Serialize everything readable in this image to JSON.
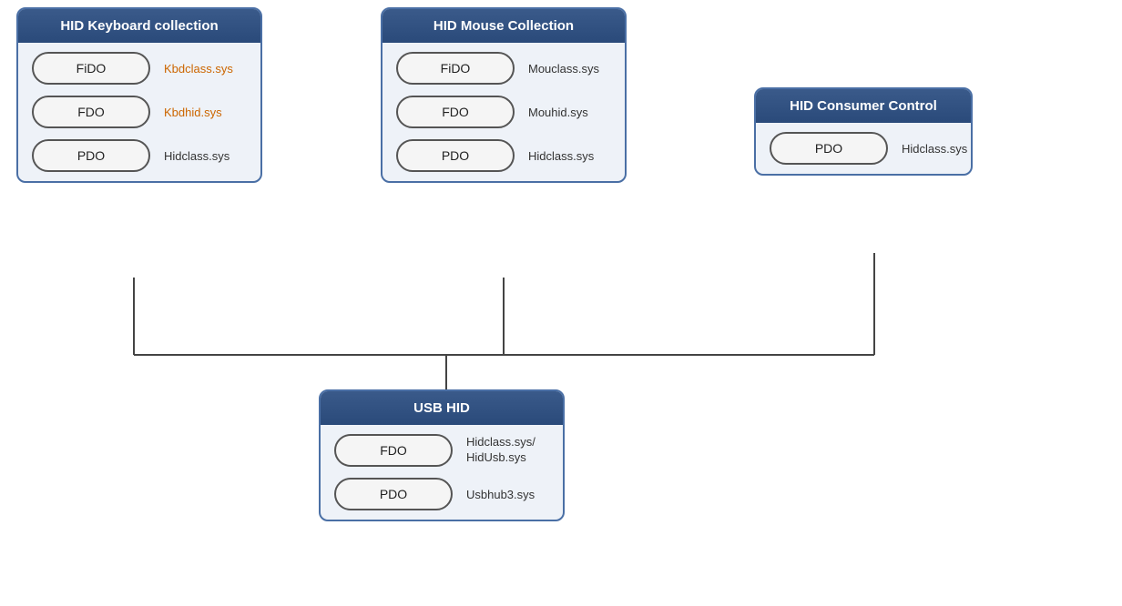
{
  "keyboard": {
    "title": "HID Keyboard collection",
    "nodes": [
      {
        "label": "FiDO",
        "sys": "Kbdclass.sys",
        "sys_color": "orange"
      },
      {
        "label": "FDO",
        "sys": "Kbdhid.sys",
        "sys_color": "orange"
      },
      {
        "label": "PDO",
        "sys": "Hidclass.sys",
        "sys_color": "dark"
      }
    ]
  },
  "mouse": {
    "title": "HID Mouse Collection",
    "nodes": [
      {
        "label": "FiDO",
        "sys": "Mouclass.sys",
        "sys_color": "dark"
      },
      {
        "label": "FDO",
        "sys": "Mouhid.sys",
        "sys_color": "dark"
      },
      {
        "label": "PDO",
        "sys": "Hidclass.sys",
        "sys_color": "dark"
      }
    ]
  },
  "consumer": {
    "title": "HID Consumer Control",
    "nodes": [
      {
        "label": "PDO",
        "sys": "Hidclass.sys",
        "sys_color": "dark"
      }
    ]
  },
  "usbhid": {
    "title": "USB HID",
    "nodes": [
      {
        "label": "FDO",
        "sys": "Hidclass.sys/\nHidUsb.sys",
        "sys_color": "dark"
      },
      {
        "label": "PDO",
        "sys": "Usbhub3.sys",
        "sys_color": "dark"
      }
    ]
  }
}
